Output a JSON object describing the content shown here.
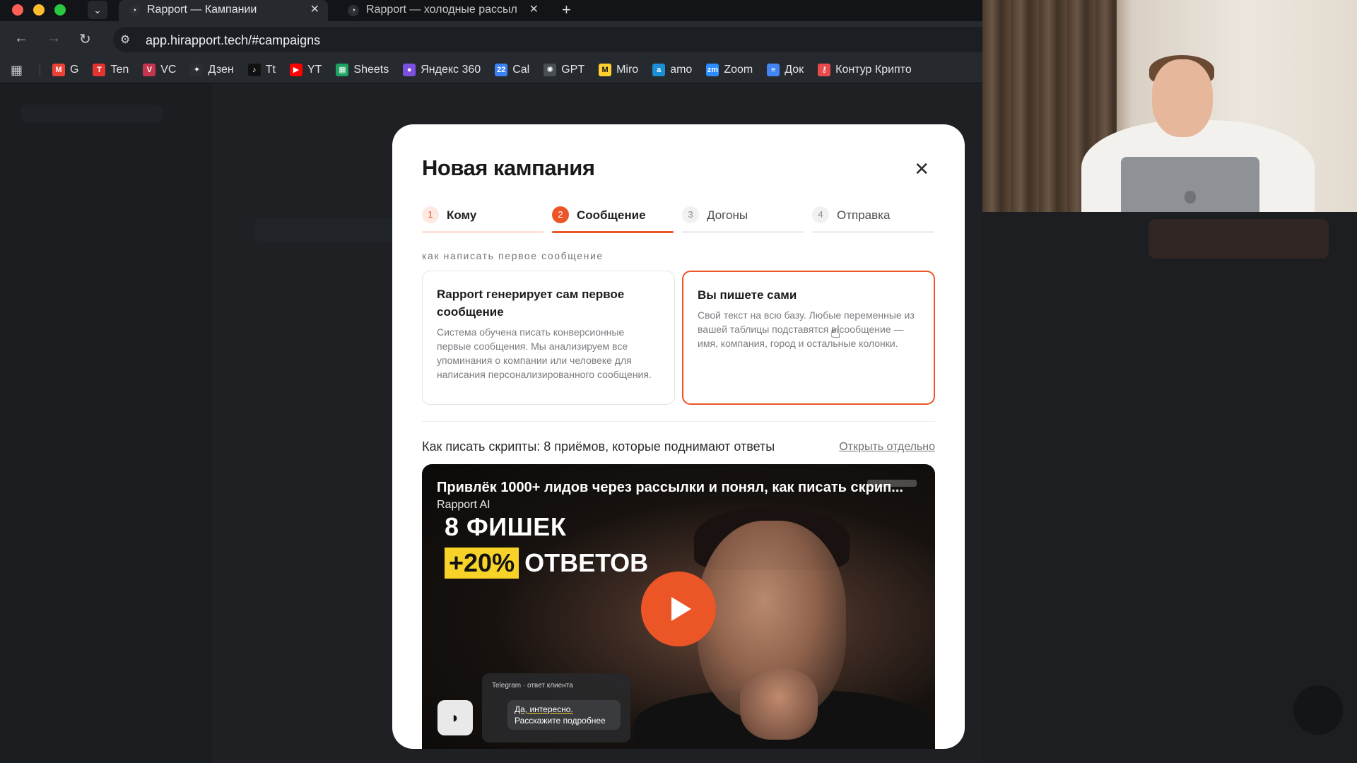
{
  "browser": {
    "tabs": [
      {
        "title": "Rapport — Кампании",
        "active": true,
        "favicon": "rapport-icon"
      },
      {
        "title": "Rapport — холодные рассыл",
        "active": false,
        "favicon": "rapport-icon"
      }
    ],
    "close_glyph": "✕",
    "new_tab_glyph": "+",
    "url": "app.hirapport.tech/#campaigns",
    "bookmarks": [
      {
        "label": "G",
        "icon": "gmail-icon",
        "color": "#ea4335",
        "glyph": "M"
      },
      {
        "label": "Ten",
        "icon": "t-icon",
        "color": "#e3342f",
        "glyph": "T"
      },
      {
        "label": "VC",
        "icon": "vc-icon",
        "color": "#c5354d",
        "glyph": "V"
      },
      {
        "label": "Дзен",
        "icon": "dzen-icon",
        "color": "#2b2f34",
        "glyph": "✦"
      },
      {
        "label": "Tt",
        "icon": "tiktok-icon",
        "color": "#111111",
        "glyph": "♪"
      },
      {
        "label": "YT",
        "icon": "youtube-icon",
        "color": "#ff0000",
        "glyph": "▶"
      },
      {
        "label": "Sheets",
        "icon": "sheets-icon",
        "color": "#1ea362",
        "glyph": "▦"
      },
      {
        "label": "Яндекс 360",
        "icon": "yandex360-icon",
        "color": "#7b4fe0",
        "glyph": "●"
      },
      {
        "label": "Cal",
        "icon": "calendar-icon",
        "color": "#3b82f6",
        "glyph": "22"
      },
      {
        "label": "GPT",
        "icon": "gpt-icon",
        "color": "#4a4f55",
        "glyph": "✺"
      },
      {
        "label": "Miro",
        "icon": "miro-icon",
        "color": "#ffd02f",
        "glyph": "M"
      },
      {
        "label": "amo",
        "icon": "amo-icon",
        "color": "#1b8fd6",
        "glyph": "a"
      },
      {
        "label": "Zoom",
        "icon": "zoom-icon",
        "color": "#2d8cff",
        "glyph": "zm"
      },
      {
        "label": "Док",
        "icon": "docs-icon",
        "color": "#4285f4",
        "glyph": "≡"
      },
      {
        "label": "Контур Крипто",
        "icon": "kontur-icon",
        "color": "#e84b4b",
        "glyph": "⚷"
      }
    ]
  },
  "modal": {
    "title": "Новая кампания",
    "close_glyph": "✕",
    "steps": [
      {
        "num": "1",
        "label": "Кому",
        "state": "done"
      },
      {
        "num": "2",
        "label": "Сообщение",
        "state": "active"
      },
      {
        "num": "3",
        "label": "Догоны",
        "state": "pending"
      },
      {
        "num": "4",
        "label": "Отправка",
        "state": "pending"
      }
    ],
    "section_label": "как написать первое сообщение",
    "options": {
      "generate": {
        "title": "Rapport генерирует сам первое сообщение",
        "description": "Система обучена писать конверсионные первые сообщения. Мы анализируем все упоминания о компании или человеке для написания персонализированного сообщения."
      },
      "manual": {
        "title": "Вы пишете сами",
        "description": "Свой текст на всю базу. Любые переменные из вашей таблицы подставятся в сообщение — имя, компания, город и остальные колонки."
      }
    },
    "video_section": {
      "heading": "Как писать скрипты: 8 приёмов, которые поднимают ответы",
      "open_link": "Открыть отдельно",
      "video_title": "Привлёк 1000+ лидов через рассылки и понял, как писать скрип...",
      "channel": "Rapport AI",
      "thumb_line1": "8 ФИШЕК",
      "thumb_badge": "+20%",
      "thumb_word": "ОТВЕТОВ",
      "telegram_header": "Telegram · ответ клиента",
      "telegram_line1": "Да, интересно.",
      "telegram_line2": "Расскажите подробнее"
    }
  },
  "colors": {
    "accent": "#ec5526",
    "highlight": "#f7d32a"
  }
}
